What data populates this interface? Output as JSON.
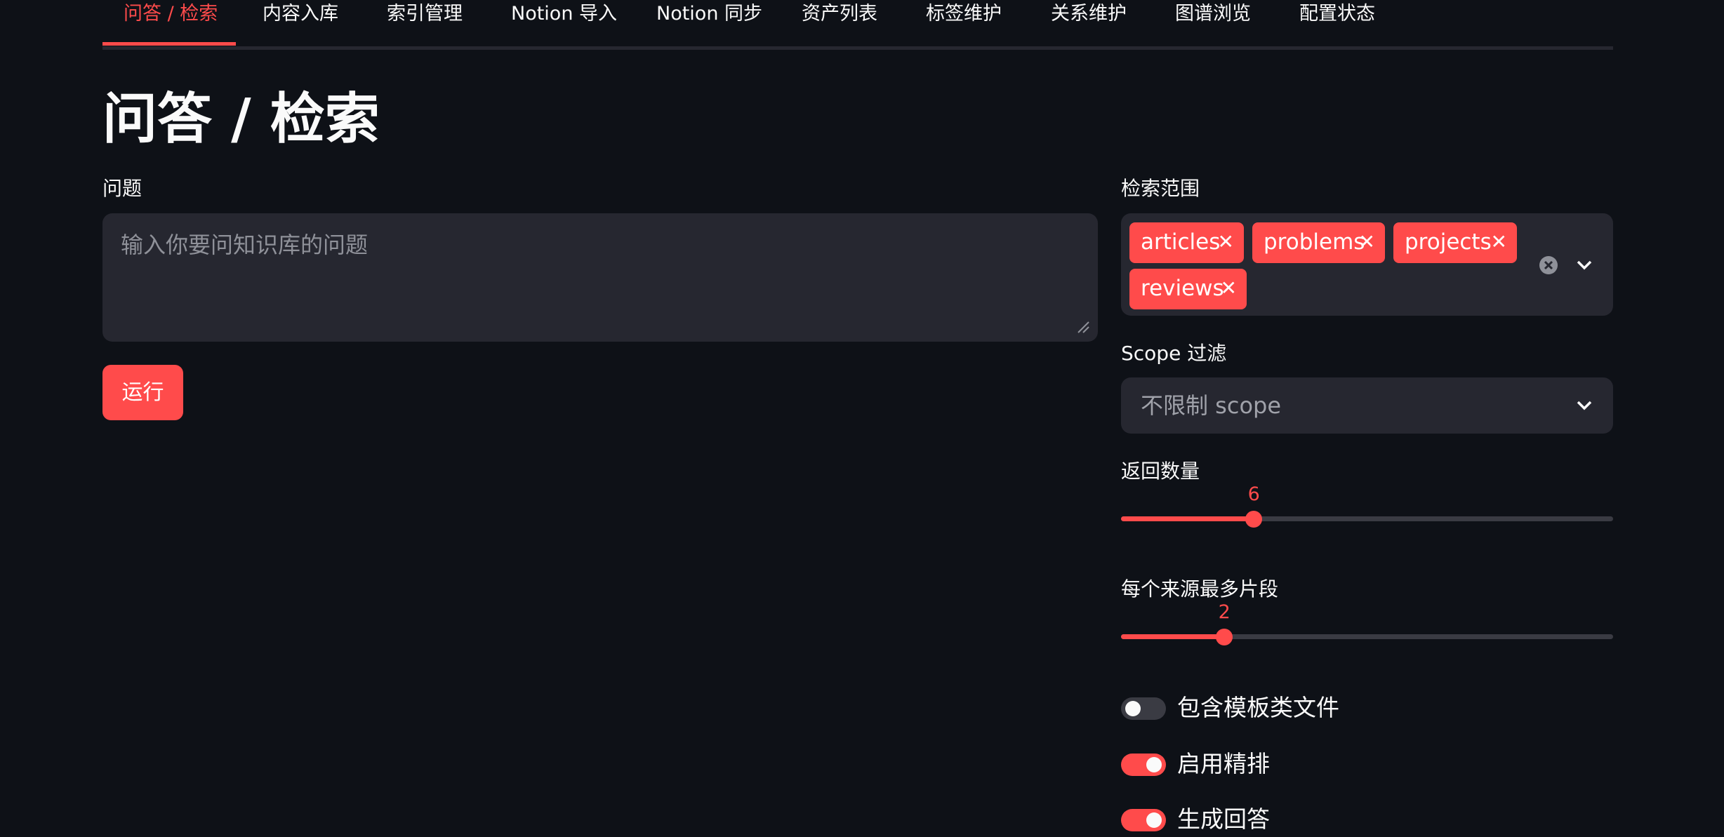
{
  "tabs": [
    "问答 / 检索",
    "内容入库",
    "索引管理",
    "Notion 导入",
    "Notion 同步",
    "资产列表",
    "标签维护",
    "关系维护",
    "图谱浏览",
    "配置状态"
  ],
  "page_title": "问答 / 检索",
  "question": {
    "label": "问题",
    "placeholder": "输入你要问知识库的问题",
    "value": ""
  },
  "run_button": "运行",
  "search_scope": {
    "label": "检索范围",
    "selected": [
      "articles",
      "problems",
      "projects",
      "reviews"
    ]
  },
  "scope_filter": {
    "label": "Scope 过滤",
    "value": "不限制 scope"
  },
  "return_count": {
    "label": "返回数量",
    "value": 6,
    "fraction": 0.27
  },
  "max_chunks": {
    "label": "每个来源最多片段",
    "value": 2,
    "fraction": 0.21
  },
  "toggles": [
    {
      "label": "包含模板类文件",
      "on": false
    },
    {
      "label": "启用精排",
      "on": true
    },
    {
      "label": "生成回答",
      "on": true
    }
  ],
  "colors": {
    "accent": "#ff4b4b",
    "background": "#0e1117",
    "surface": "#262730"
  }
}
